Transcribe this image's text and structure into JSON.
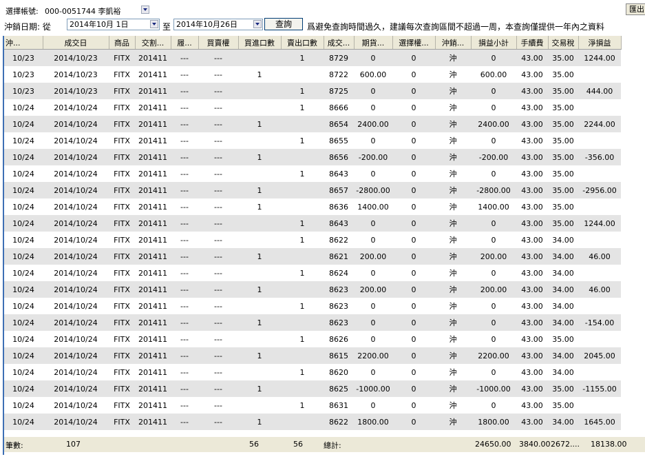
{
  "header": {
    "account_label": "選擇帳號:",
    "account_value": "000-0051744 李凱裕",
    "export_label": "匯出",
    "date_label": "沖銷日期: 從",
    "date_from": "2014年10月  1日",
    "date_to_label": "至",
    "date_to": "2014年10月26日",
    "query_label": "查詢",
    "notice": "爲避免查詢時間過久，建議每次查詢區間不超過一周，本查詢僅提供一年內之資料"
  },
  "table": {
    "columns": [
      "沖...",
      "成交日",
      "商品",
      "交割...",
      "履...",
      "買賣權",
      "買進口數",
      "賣出口數",
      "成交...",
      "期貨...",
      "選擇權...",
      "沖銷...",
      "損益小計",
      "手續費",
      "交易稅",
      "淨損益"
    ],
    "rows": [
      [
        "10/23",
        "2014/10/23",
        "FITX",
        "201411",
        "---",
        "---",
        "",
        "1",
        "8729",
        "0",
        "0",
        "沖",
        "0",
        "43.00",
        "35.00",
        "1244.00"
      ],
      [
        "10/23",
        "2014/10/23",
        "FITX",
        "201411",
        "---",
        "---",
        "1",
        "",
        "8722",
        "600.00",
        "0",
        "沖",
        "600.00",
        "43.00",
        "35.00",
        ""
      ],
      [
        "10/23",
        "2014/10/23",
        "FITX",
        "201411",
        "---",
        "---",
        "",
        "1",
        "8725",
        "0",
        "0",
        "沖",
        "0",
        "43.00",
        "35.00",
        "444.00"
      ],
      [
        "10/24",
        "2014/10/24",
        "FITX",
        "201411",
        "---",
        "---",
        "",
        "1",
        "8666",
        "0",
        "0",
        "沖",
        "0",
        "43.00",
        "35.00",
        ""
      ],
      [
        "10/24",
        "2014/10/24",
        "FITX",
        "201411",
        "---",
        "---",
        "1",
        "",
        "8654",
        "2400.00",
        "0",
        "沖",
        "2400.00",
        "43.00",
        "35.00",
        "2244.00"
      ],
      [
        "10/24",
        "2014/10/24",
        "FITX",
        "201411",
        "---",
        "---",
        "",
        "1",
        "8655",
        "0",
        "0",
        "沖",
        "0",
        "43.00",
        "35.00",
        ""
      ],
      [
        "10/24",
        "2014/10/24",
        "FITX",
        "201411",
        "---",
        "---",
        "1",
        "",
        "8656",
        "-200.00",
        "0",
        "沖",
        "-200.00",
        "43.00",
        "35.00",
        "-356.00"
      ],
      [
        "10/24",
        "2014/10/24",
        "FITX",
        "201411",
        "---",
        "---",
        "",
        "1",
        "8643",
        "0",
        "0",
        "沖",
        "0",
        "43.00",
        "35.00",
        ""
      ],
      [
        "10/24",
        "2014/10/24",
        "FITX",
        "201411",
        "---",
        "---",
        "1",
        "",
        "8657",
        "-2800.00",
        "0",
        "沖",
        "-2800.00",
        "43.00",
        "35.00",
        "-2956.00"
      ],
      [
        "10/24",
        "2014/10/24",
        "FITX",
        "201411",
        "---",
        "---",
        "1",
        "",
        "8636",
        "1400.00",
        "0",
        "沖",
        "1400.00",
        "43.00",
        "35.00",
        ""
      ],
      [
        "10/24",
        "2014/10/24",
        "FITX",
        "201411",
        "---",
        "---",
        "",
        "1",
        "8643",
        "0",
        "0",
        "沖",
        "0",
        "43.00",
        "35.00",
        "1244.00"
      ],
      [
        "10/24",
        "2014/10/24",
        "FITX",
        "201411",
        "---",
        "---",
        "",
        "1",
        "8622",
        "0",
        "0",
        "沖",
        "0",
        "43.00",
        "34.00",
        ""
      ],
      [
        "10/24",
        "2014/10/24",
        "FITX",
        "201411",
        "---",
        "---",
        "1",
        "",
        "8621",
        "200.00",
        "0",
        "沖",
        "200.00",
        "43.00",
        "34.00",
        "46.00"
      ],
      [
        "10/24",
        "2014/10/24",
        "FITX",
        "201411",
        "---",
        "---",
        "",
        "1",
        "8624",
        "0",
        "0",
        "沖",
        "0",
        "43.00",
        "34.00",
        ""
      ],
      [
        "10/24",
        "2014/10/24",
        "FITX",
        "201411",
        "---",
        "---",
        "1",
        "",
        "8623",
        "200.00",
        "0",
        "沖",
        "200.00",
        "43.00",
        "34.00",
        "46.00"
      ],
      [
        "10/24",
        "2014/10/24",
        "FITX",
        "201411",
        "---",
        "---",
        "",
        "1",
        "8623",
        "0",
        "0",
        "沖",
        "0",
        "43.00",
        "34.00",
        ""
      ],
      [
        "10/24",
        "2014/10/24",
        "FITX",
        "201411",
        "---",
        "---",
        "1",
        "",
        "8623",
        "0",
        "0",
        "沖",
        "0",
        "43.00",
        "34.00",
        "-154.00"
      ],
      [
        "10/24",
        "2014/10/24",
        "FITX",
        "201411",
        "---",
        "---",
        "",
        "1",
        "8626",
        "0",
        "0",
        "沖",
        "0",
        "43.00",
        "35.00",
        ""
      ],
      [
        "10/24",
        "2014/10/24",
        "FITX",
        "201411",
        "---",
        "---",
        "1",
        "",
        "8615",
        "2200.00",
        "0",
        "沖",
        "2200.00",
        "43.00",
        "34.00",
        "2045.00"
      ],
      [
        "10/24",
        "2014/10/24",
        "FITX",
        "201411",
        "---",
        "---",
        "",
        "1",
        "8620",
        "0",
        "0",
        "沖",
        "0",
        "43.00",
        "34.00",
        ""
      ],
      [
        "10/24",
        "2014/10/24",
        "FITX",
        "201411",
        "---",
        "---",
        "1",
        "",
        "8625",
        "-1000.00",
        "0",
        "沖",
        "-1000.00",
        "43.00",
        "35.00",
        "-1155.00"
      ],
      [
        "10/24",
        "2014/10/24",
        "FITX",
        "201411",
        "---",
        "---",
        "",
        "1",
        "8631",
        "0",
        "0",
        "沖",
        "0",
        "43.00",
        "35.00",
        ""
      ],
      [
        "10/24",
        "2014/10/24",
        "FITX",
        "201411",
        "---",
        "---",
        "1",
        "",
        "8622",
        "1800.00",
        "0",
        "沖",
        "1800.00",
        "43.00",
        "34.00",
        "1645.00"
      ]
    ]
  },
  "footer": {
    "count_label": "筆數:",
    "count_value": "107",
    "buy_total": "56",
    "sell_total": "56",
    "total_label": "總計:",
    "pnl_total": "24650.00",
    "fee_total": "3840.00",
    "tax_total": "2672....",
    "net_total": "18138.00"
  }
}
